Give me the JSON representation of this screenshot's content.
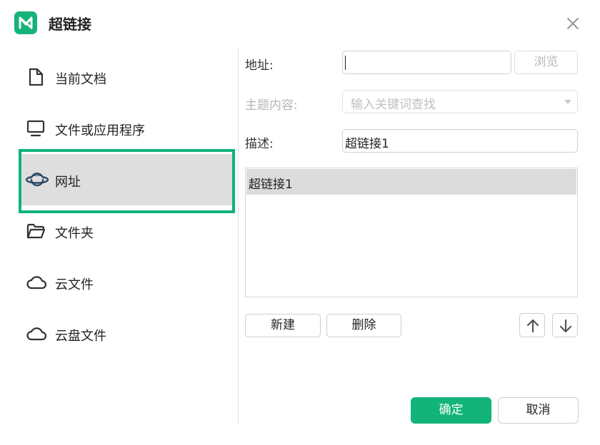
{
  "dialog": {
    "title": "超链接"
  },
  "sidebar": {
    "items": [
      {
        "label": "当前文档",
        "icon": "document-icon"
      },
      {
        "label": "文件或应用程序",
        "icon": "monitor-icon"
      },
      {
        "label": "网址",
        "icon": "planet-icon",
        "active": true
      },
      {
        "label": "文件夹",
        "icon": "folder-icon"
      },
      {
        "label": "云文件",
        "icon": "cloud-icon"
      },
      {
        "label": "云盘文件",
        "icon": "cloud-icon"
      }
    ]
  },
  "form": {
    "address_label": "地址:",
    "address_value": "",
    "browse_label": "浏览",
    "topic_label": "主题内容:",
    "topic_placeholder": "输入关键词查找",
    "description_label": "描述:",
    "description_value": "超链接1"
  },
  "list": {
    "items": [
      "超链接1"
    ]
  },
  "actions": {
    "new_label": "新建",
    "delete_label": "删除",
    "ok_label": "确定",
    "cancel_label": "取消"
  },
  "colors": {
    "accent": "#12b47a",
    "focus_ring": "#0fb37a",
    "selected_bg": "#dedede"
  }
}
